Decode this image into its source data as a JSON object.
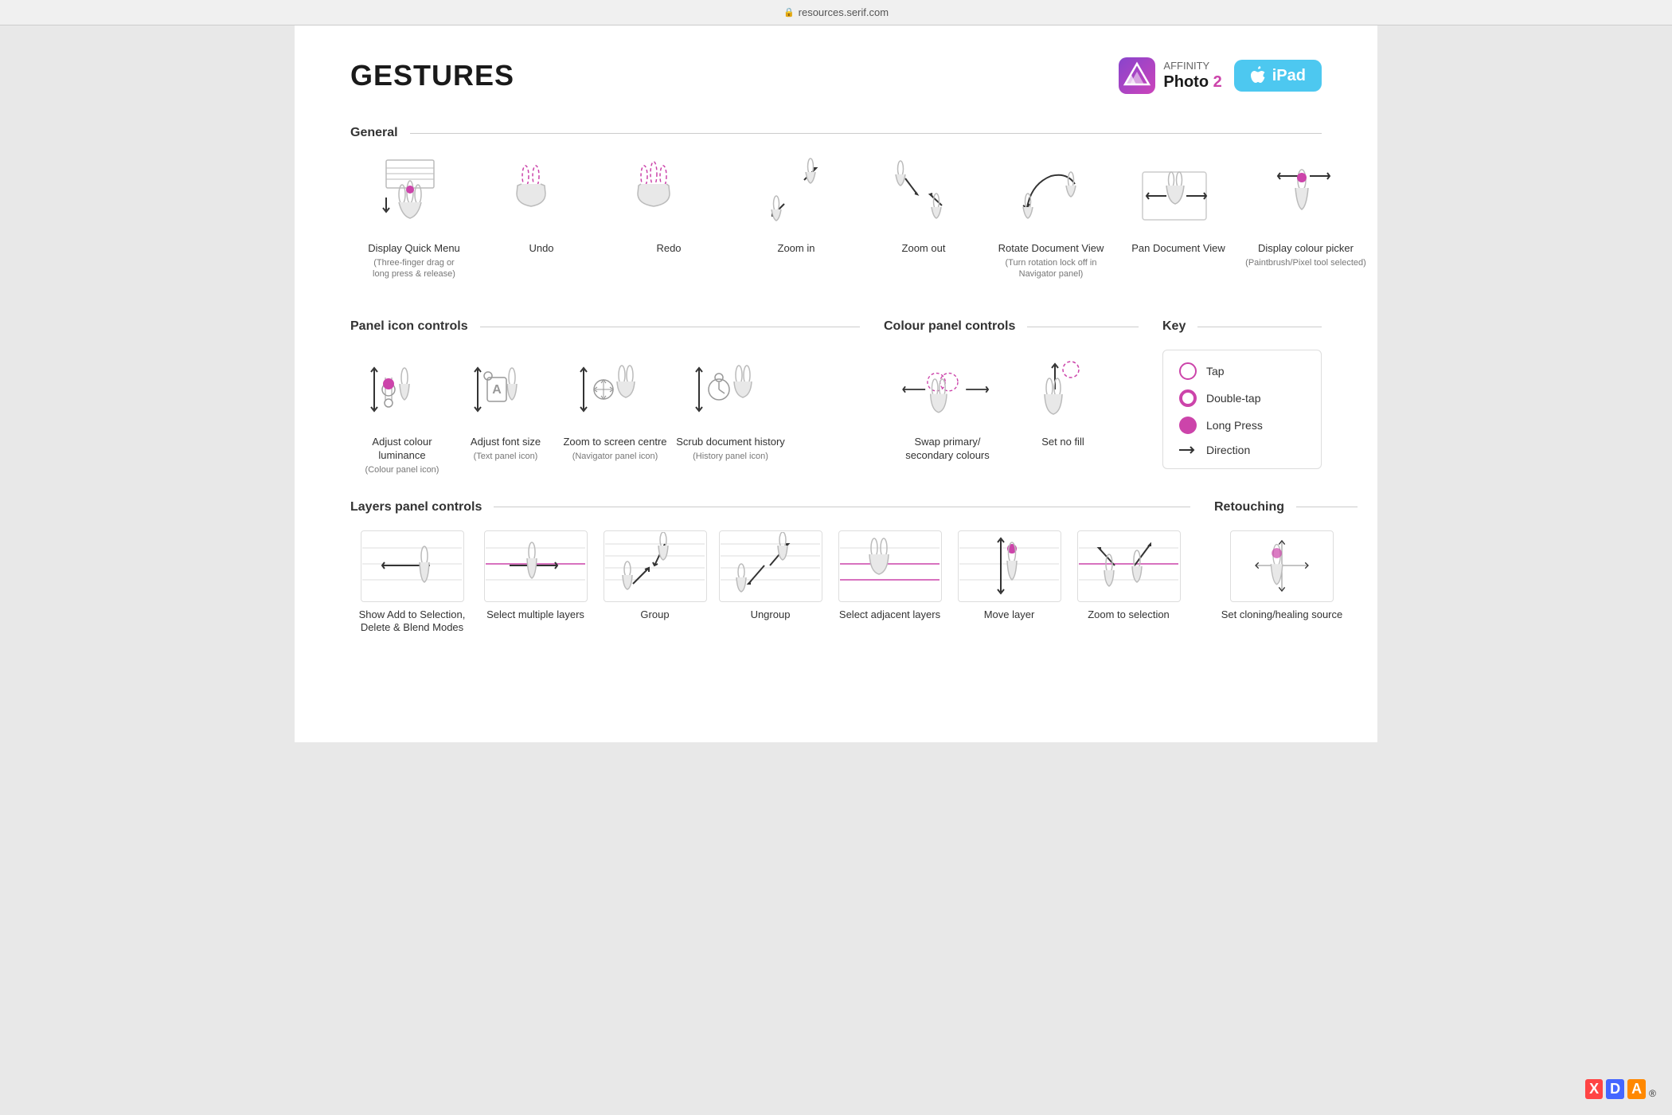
{
  "browser": {
    "url": "resources.serif.com",
    "lock_icon": "🔒"
  },
  "header": {
    "title": "GESTURES",
    "affinity_label": "AFFINITY",
    "photo2_label": "Photo 2",
    "ipad_label": "iPad"
  },
  "sections": {
    "general": {
      "title": "General",
      "gestures": [
        {
          "id": "display-quick-menu",
          "label": "Display Quick Menu",
          "sublabel": "(Three-finger drag or\nlong press & release)",
          "type": "three-finger-down"
        },
        {
          "id": "undo",
          "label": "Undo",
          "sublabel": "",
          "type": "two-finger-tap"
        },
        {
          "id": "redo",
          "label": "Redo",
          "sublabel": "",
          "type": "three-finger-tap"
        },
        {
          "id": "zoom-in",
          "label": "Zoom in",
          "sublabel": "",
          "type": "two-finger-spread"
        },
        {
          "id": "zoom-out",
          "label": "Zoom out",
          "sublabel": "",
          "type": "two-finger-pinch"
        },
        {
          "id": "rotate-doc-view",
          "label": "Rotate Document View",
          "sublabel": "(Turn rotation lock off in\nNavigator panel)",
          "type": "two-finger-rotate"
        },
        {
          "id": "pan-doc-view",
          "label": "Pan Document View",
          "sublabel": "",
          "type": "two-finger-pan"
        },
        {
          "id": "display-colour-picker",
          "label": "Display colour picker",
          "sublabel": "(Paintbrush/Pixel tool selected)",
          "type": "longpress-one"
        }
      ]
    },
    "panel_icon": {
      "title": "Panel icon controls",
      "gestures": [
        {
          "id": "adjust-colour-luminance",
          "label": "Adjust colour luminance",
          "sublabel": "(Colour panel icon)",
          "type": "swipe-up-down-circle"
        },
        {
          "id": "adjust-font-size",
          "label": "Adjust font size",
          "sublabel": "(Text panel icon)",
          "type": "swipe-up-down-a"
        },
        {
          "id": "zoom-to-screen-centre",
          "label": "Zoom to screen centre",
          "sublabel": "(Navigator panel icon)",
          "type": "swipe-up-down-move"
        },
        {
          "id": "scrub-doc-history",
          "label": "Scrub document history",
          "sublabel": "(History panel icon)",
          "type": "swipe-up-down-clock"
        },
        {
          "id": "swap-colours",
          "label": "Swap primary/\nsecondary colours",
          "sublabel": "",
          "type": "swipe-left-right"
        },
        {
          "id": "set-no-fill",
          "label": "Set no fill",
          "sublabel": "",
          "type": "swipe-up"
        }
      ]
    },
    "colour_panel": {
      "title": "Colour panel controls",
      "gestures": []
    },
    "key": {
      "title": "Key",
      "items": [
        {
          "id": "tap",
          "label": "Tap",
          "icon": "tap"
        },
        {
          "id": "double-tap",
          "label": "Double-tap",
          "icon": "doubletap"
        },
        {
          "id": "long-press",
          "label": "Long Press",
          "icon": "longpress"
        },
        {
          "id": "direction",
          "label": "Direction",
          "icon": "direction"
        }
      ]
    },
    "layers": {
      "title": "Layers panel controls",
      "gestures": [
        {
          "id": "show-add-to-selection",
          "label": "Show Add to Selection,\nDelete & Blend Modes",
          "sublabel": "",
          "type": "swipe-right"
        },
        {
          "id": "select-multiple-layers",
          "label": "Select multiple layers",
          "sublabel": "",
          "type": "swipe-right-grid"
        },
        {
          "id": "group",
          "label": "Group",
          "sublabel": "",
          "type": "pinch-in-grid"
        },
        {
          "id": "ungroup",
          "label": "Ungroup",
          "sublabel": "",
          "type": "spread-out-grid"
        },
        {
          "id": "select-adjacent-layers",
          "label": "Select adjacent layers",
          "sublabel": "",
          "type": "two-finger-tap-grid"
        },
        {
          "id": "move-layer",
          "label": "Move layer",
          "sublabel": "",
          "type": "swipe-up-down-grid"
        },
        {
          "id": "zoom-to-selection",
          "label": "Zoom to selection",
          "sublabel": "",
          "type": "spread-grid"
        }
      ]
    },
    "retouching": {
      "title": "Retouching",
      "gestures": [
        {
          "id": "set-cloning-healing-source",
          "label": "Set cloning/healing source",
          "sublabel": "",
          "type": "longpress-move"
        }
      ]
    }
  }
}
